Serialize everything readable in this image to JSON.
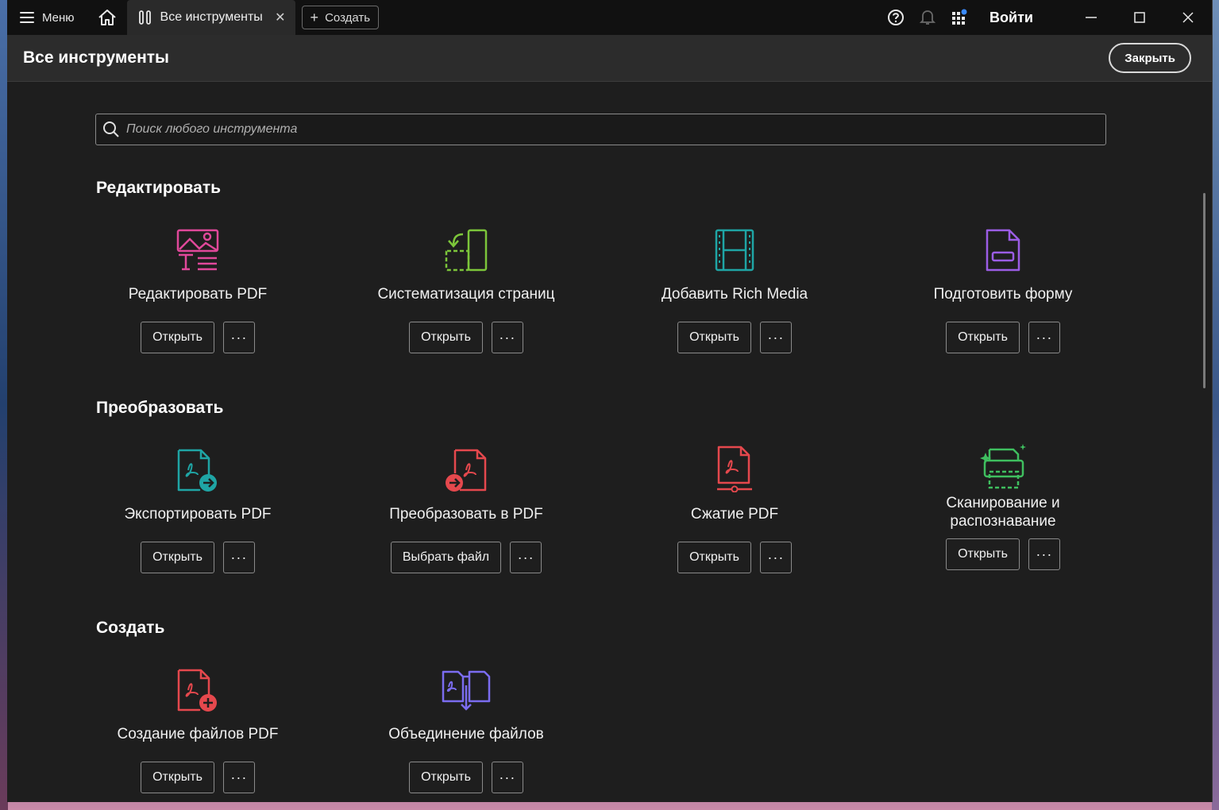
{
  "titlebar": {
    "menu_label": "Меню",
    "tab_label": "Все инструменты",
    "tab_close": "✕",
    "create_label": "Создать",
    "signin_label": "Войти"
  },
  "header": {
    "title": "Все инструменты",
    "close_label": "Закрыть"
  },
  "search": {
    "placeholder": "Поиск любого инструмента"
  },
  "sections": {
    "edit": {
      "title": "Редактировать",
      "tools": [
        {
          "label": "Редактировать PDF",
          "action": "Открыть",
          "icon": "edit-pdf-icon"
        },
        {
          "label": "Систематизация страниц",
          "action": "Открыть",
          "icon": "organize-pages-icon"
        },
        {
          "label": "Добавить Rich Media",
          "action": "Открыть",
          "icon": "rich-media-icon"
        },
        {
          "label": "Подготовить форму",
          "action": "Открыть",
          "icon": "prepare-form-icon"
        }
      ]
    },
    "convert": {
      "title": "Преобразовать",
      "tools": [
        {
          "label": "Экспортировать PDF",
          "action": "Открыть",
          "icon": "export-pdf-icon"
        },
        {
          "label": "Преобразовать в PDF",
          "action": "Выбрать файл",
          "icon": "convert-to-pdf-icon"
        },
        {
          "label": "Сжатие PDF",
          "action": "Открыть",
          "icon": "compress-pdf-icon"
        },
        {
          "label": "Сканирование и распознавание",
          "action": "Открыть",
          "icon": "scan-ocr-icon"
        }
      ]
    },
    "create": {
      "title": "Создать",
      "tools": [
        {
          "label": "Создание файлов PDF",
          "action": "Открыть",
          "icon": "create-pdf-icon"
        },
        {
          "label": "Объединение файлов",
          "action": "Открыть",
          "icon": "combine-files-icon"
        }
      ]
    }
  },
  "more_label": "···",
  "colors": {
    "edit_pdf": "#e0489a",
    "organize": "#7cc63a",
    "rich_media": "#1fa5a5",
    "form": "#9b5de5",
    "export": "#1fa5a5",
    "pdf_red": "#e5484d",
    "scan": "#3fbf5f",
    "combine": "#7b6cf0"
  }
}
